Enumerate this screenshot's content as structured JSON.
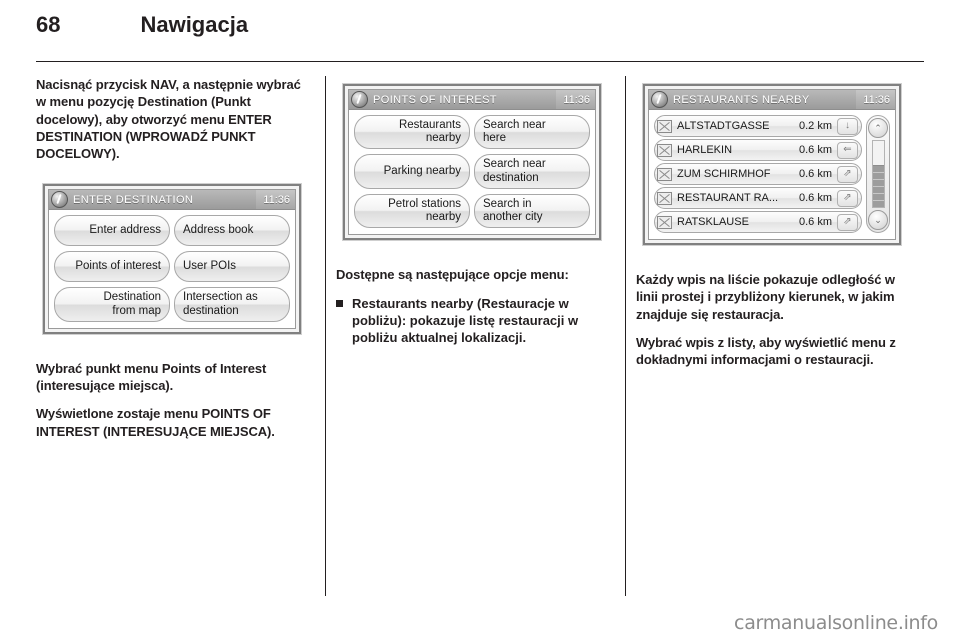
{
  "header": {
    "page_number": "68",
    "title": "Nawigacja"
  },
  "col1": {
    "para1": "Nacisnąć przycisk NAV, a następnie wybrać w menu pozycję Destination (Punkt docelowy), aby otworzyć menu ENTER DESTINATION (WPROWADŹ PUNKT DOCELOWY).",
    "para2": "Wybrać punkt menu Points of Interest (interesujące miejsca).",
    "para3": "Wyświetlone zostaje menu POINTS OF INTEREST (INTERESUJĄCE MIEJSCA).",
    "screen": {
      "info_icon": "info-icon",
      "title": "ENTER DESTINATION",
      "clock": "11:36",
      "rows": [
        {
          "left": "Enter address",
          "right": "Address book"
        },
        {
          "left": "Points of interest",
          "right": "User POIs"
        },
        {
          "left": "Destination\nfrom map",
          "right": "Intersection as\ndestination"
        }
      ]
    }
  },
  "col2": {
    "para1": "Dostępne są następujące opcje menu:",
    "bullets": [
      "Restaurants nearby (Restauracje w pobliżu): pokazuje listę restauracji w pobliżu aktualnej lokalizacji."
    ],
    "screen": {
      "info_icon": "info-icon",
      "title": "POINTS OF INTEREST",
      "clock": "11:36",
      "rows": [
        {
          "left": "Restaurants\nnearby",
          "right": "Search near\nhere"
        },
        {
          "left": "Parking nearby",
          "right": "Search near\ndestination"
        },
        {
          "left": "Petrol stations\nnearby",
          "right": "Search in\nanother city"
        }
      ]
    }
  },
  "col3": {
    "para1": "Każdy wpis na liście pokazuje odległość w linii prostej i przybliżony kierunek, w jakim znajduje się restauracja.",
    "para2": "Wybrać wpis z listy, aby wyświetlić menu z dokładnymi informacjami o restauracji.",
    "screen": {
      "info_icon": "info-icon",
      "title": "RESTAURANTS NEARBY",
      "clock": "11:36",
      "rows": [
        {
          "icon": "restaurant-icon",
          "name": "ALTSTADTGASSE",
          "distance": "0.2 km",
          "direction": "↓",
          "direction_name": "arrow-down-icon"
        },
        {
          "icon": "restaurant-icon",
          "name": "HARLEKIN",
          "distance": "0.6 km",
          "direction": "⇐",
          "direction_name": "arrow-left-icon"
        },
        {
          "icon": "restaurant-icon",
          "name": "ZUM SCHIRMHOF",
          "distance": "0.6 km",
          "direction": "⇗",
          "direction_name": "arrow-up-right-icon"
        },
        {
          "icon": "restaurant-icon",
          "name": "RESTAURANT RA...",
          "distance": "0.6 km",
          "direction": "⇗",
          "direction_name": "arrow-up-right-icon"
        },
        {
          "icon": "restaurant-icon",
          "name": "RATSKLAUSE",
          "distance": "0.6 km",
          "direction": "⇗",
          "direction_name": "arrow-up-right-icon"
        }
      ],
      "scroll_up": "⌃",
      "scroll_down": "⌄"
    }
  },
  "watermark": "carmanualsonline.info",
  "colors": {
    "text": "#231f20",
    "screen_frame": "#808080",
    "screen_title_bar": "#a6a6a6",
    "watermark": "#8c8c8c"
  }
}
